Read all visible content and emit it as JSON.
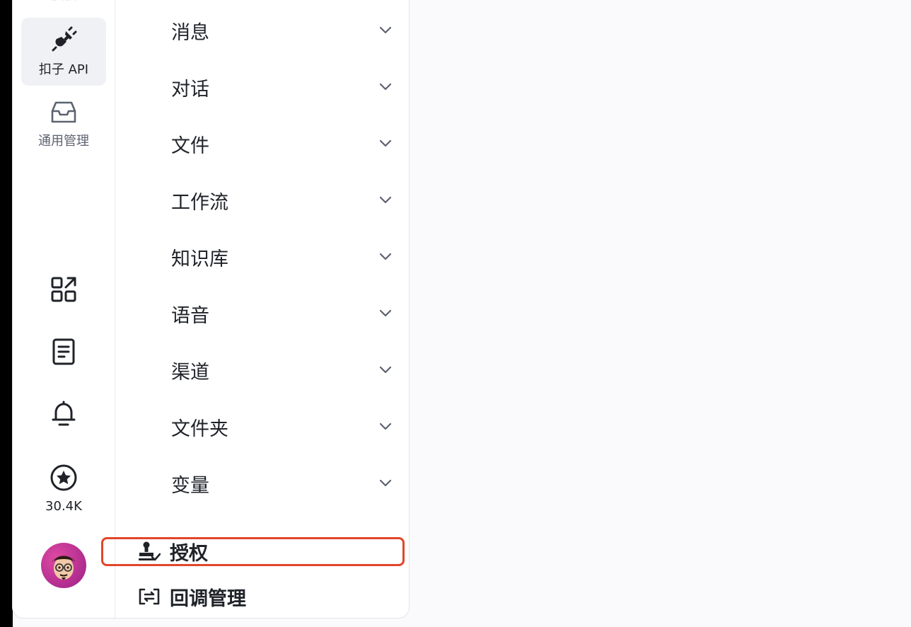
{
  "rail": {
    "top_cut_label": "模板",
    "items": [
      {
        "label": "扣子 API",
        "icon": "plug-icon",
        "active": true
      },
      {
        "label": "通用管理",
        "icon": "inbox-icon",
        "active": false
      }
    ],
    "bottom_icons": [
      {
        "icon": "apps-icon"
      },
      {
        "icon": "document-icon"
      },
      {
        "icon": "bell-icon"
      }
    ],
    "star": {
      "icon": "star-circle-icon",
      "count": "30.4K"
    },
    "avatar": {
      "icon": "avatar-icon"
    }
  },
  "nav": {
    "items": [
      {
        "label": "消息"
      },
      {
        "label": "对话"
      },
      {
        "label": "文件"
      },
      {
        "label": "工作流"
      },
      {
        "label": "知识库"
      },
      {
        "label": "语音"
      },
      {
        "label": "渠道"
      },
      {
        "label": "文件夹"
      },
      {
        "label": "变量"
      }
    ],
    "auth": {
      "label": "授权",
      "icon": "stamp-icon"
    },
    "callback": {
      "label": "回调管理",
      "icon": "callback-icon"
    }
  },
  "colors": {
    "highlight": "#e2462b",
    "active_bg": "#f0f1f4"
  }
}
